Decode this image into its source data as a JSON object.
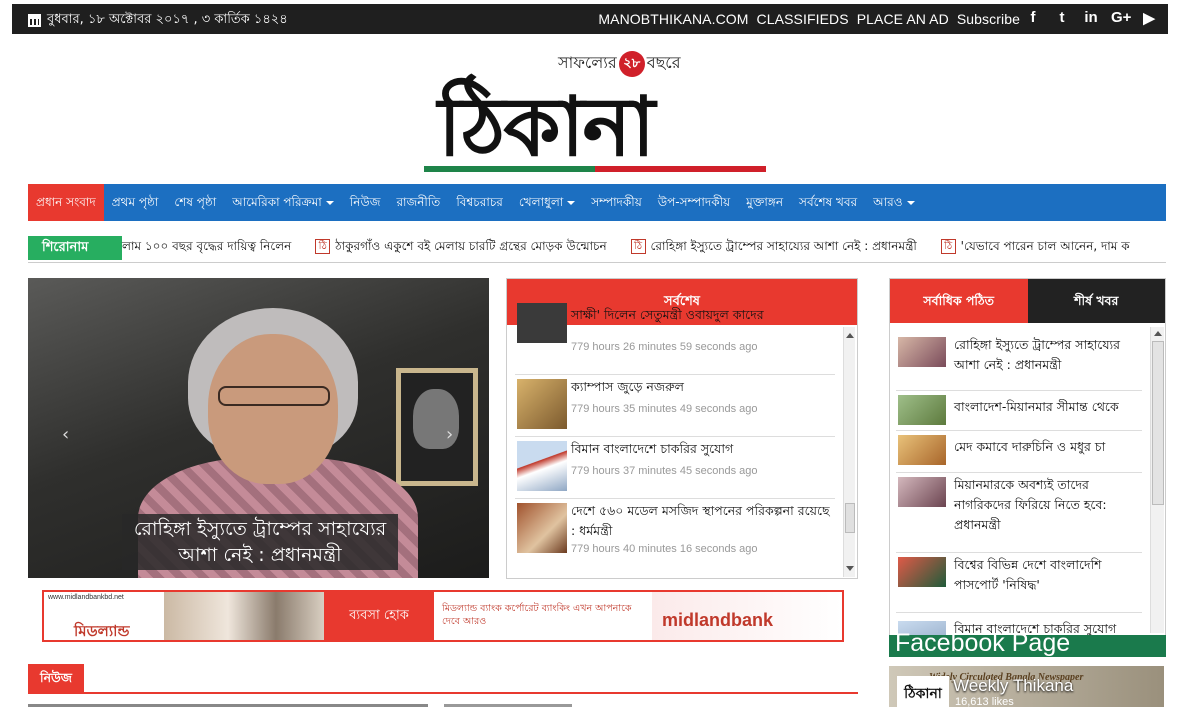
{
  "topbar": {
    "date": "বুধবার, ১৮ অক্টোবর ২০১৭ , ৩ কার্তিক ১৪২৪",
    "links": [
      "MANOBTHIKANA.COM",
      "CLASSIFIEDS",
      "PLACE AN AD",
      "Subscribe"
    ],
    "social_icons": [
      "facebook-icon",
      "twitter-icon",
      "linkedin-icon",
      "google-plus-icon",
      "youtube-icon"
    ],
    "social_glyphs": [
      "f",
      "t",
      "in",
      "G+",
      "▶"
    ]
  },
  "masthead": {
    "tagline_before": "সাফল্যের",
    "tagline_badge": "২৮",
    "tagline_after": "বছরে",
    "logo": "ঠিকানা"
  },
  "nav": {
    "items": [
      {
        "label": "প্রধান সংবাদ",
        "active": true
      },
      {
        "label": "প্রথম পৃষ্ঠা"
      },
      {
        "label": "শেষ পৃষ্ঠা"
      },
      {
        "label": "আমেরিকা পরিক্রমা",
        "dropdown": true
      },
      {
        "label": "নিউজ"
      },
      {
        "label": "রাজনীতি"
      },
      {
        "label": "বিশ্বচরাচর"
      },
      {
        "label": "খেলাধুলা",
        "dropdown": true
      },
      {
        "label": "সম্পাদকীয়"
      },
      {
        "label": "উপ-সম্পাদকীয়"
      },
      {
        "label": "মুক্তাঙ্গন"
      },
      {
        "label": "সর্বশেষ খবর"
      },
      {
        "label": "আরও",
        "dropdown": true
      }
    ]
  },
  "ticker": {
    "label": "শিরোনাম",
    "items": [
      "লাম ১০০ বছর বৃদ্ধের দায়িত্ব নিলেন",
      "ঠাকুরগাঁও একুশে বই মেলায় চারটি গ্রন্থের মোড়ক উন্মোচন",
      "রোহিঙ্গা ইস্যুতে ট্রাম্পের সাহায্যের আশা নেই : প্রধানমন্ত্রী",
      "'যেভাবে পারেন চাল আনেন, দাম ক"
    ]
  },
  "slider": {
    "caption": "রোহিঙ্গা ইস্যুতে ট্রাম্পের সাহায্যের আশা নেই : প্রধানমন্ত্রী",
    "prev_glyph": "‹",
    "next_glyph": "›"
  },
  "latest": {
    "title": "সর্বশেষ",
    "items": [
      {
        "title": "সাক্ষী' দিলেন সেতুমন্ত্রী ওবায়দুল কাদের",
        "ago": "779 hours 26 minutes 59 seconds ago",
        "thumb_color": "#3a3a3a"
      },
      {
        "title": "ক্যাম্পাস জুড়ে নজরুল",
        "ago": "779 hours 35 minutes 49 seconds ago",
        "thumb_color": "#b58a4a"
      },
      {
        "title": "বিমান বাংলাদেশে চাকরির সুযোগ",
        "ago": "779 hours 37 minutes 45 seconds ago",
        "thumb_color": "#8fa7c4"
      },
      {
        "title": "দেশে ৫৬০ মডেল মসজিদ স্থাপনের পরিকল্পনা রয়েছে : ধর্মমন্ত্রী",
        "ago": "779 hours 40 minutes 16 seconds ago",
        "thumb_color": "#a0522d"
      }
    ]
  },
  "ad": {
    "url": "www.midlandbankbd.net",
    "left_brand": "মিডল্যান্ড",
    "slogan": "ব্যবসা হোক",
    "middle_text": "মিডল্যান্ড ব্যাংক কর্পোরেট ব্যাংকিং এখন আপনাকে দেবে আরও",
    "right_brand": "midlandbank"
  },
  "news_section": {
    "title": "নিউজ"
  },
  "popular": {
    "tab_most_read": "সর্বাধিক পঠিত",
    "tab_top_news": "শীর্ষ খবর",
    "items": [
      {
        "title": "রোহিঙ্গা ইস্যুতে ট্রাম্পের সাহায্যের আশা নেই : প্রধানমন্ত্রী",
        "thumb_color": "#9b6b6b"
      },
      {
        "title": "বাংলাদেশ-মিয়ানমার সীমান্ত থেকে",
        "thumb_color": "#7a8f5a"
      },
      {
        "title": "মেদ কমাবে দারুচিনি ও মধুর চা",
        "thumb_color": "#c28b3c"
      },
      {
        "title": "মিয়ানমারকে অবশ্যই তাদের নাগরিকদের ফিরিয়ে নিতে হবে: প্রধানমন্ত্রী",
        "thumb_color": "#8c6a70"
      },
      {
        "title": "বিশ্বের বিভিন্ন দেশে বাংলাদেশি পাসপোর্ট 'নিষিদ্ধ'",
        "thumb_color": "#b03a2e"
      },
      {
        "title": "বিমান বাংলাদেশে চাকরির সুযোগ",
        "thumb_color": "#8fa7c4"
      }
    ]
  },
  "facebook": {
    "bar_title": "Facebook Page",
    "tagline": "Widely Circulated Bangla Newspaper",
    "page_name": "Weekly Thikana",
    "likes": "16,613 likes",
    "logo_text": "ঠিকানা"
  },
  "colors": {
    "accent_red": "#e8392f",
    "nav_blue": "#1c6fc1",
    "ticker_green": "#27ae60"
  }
}
